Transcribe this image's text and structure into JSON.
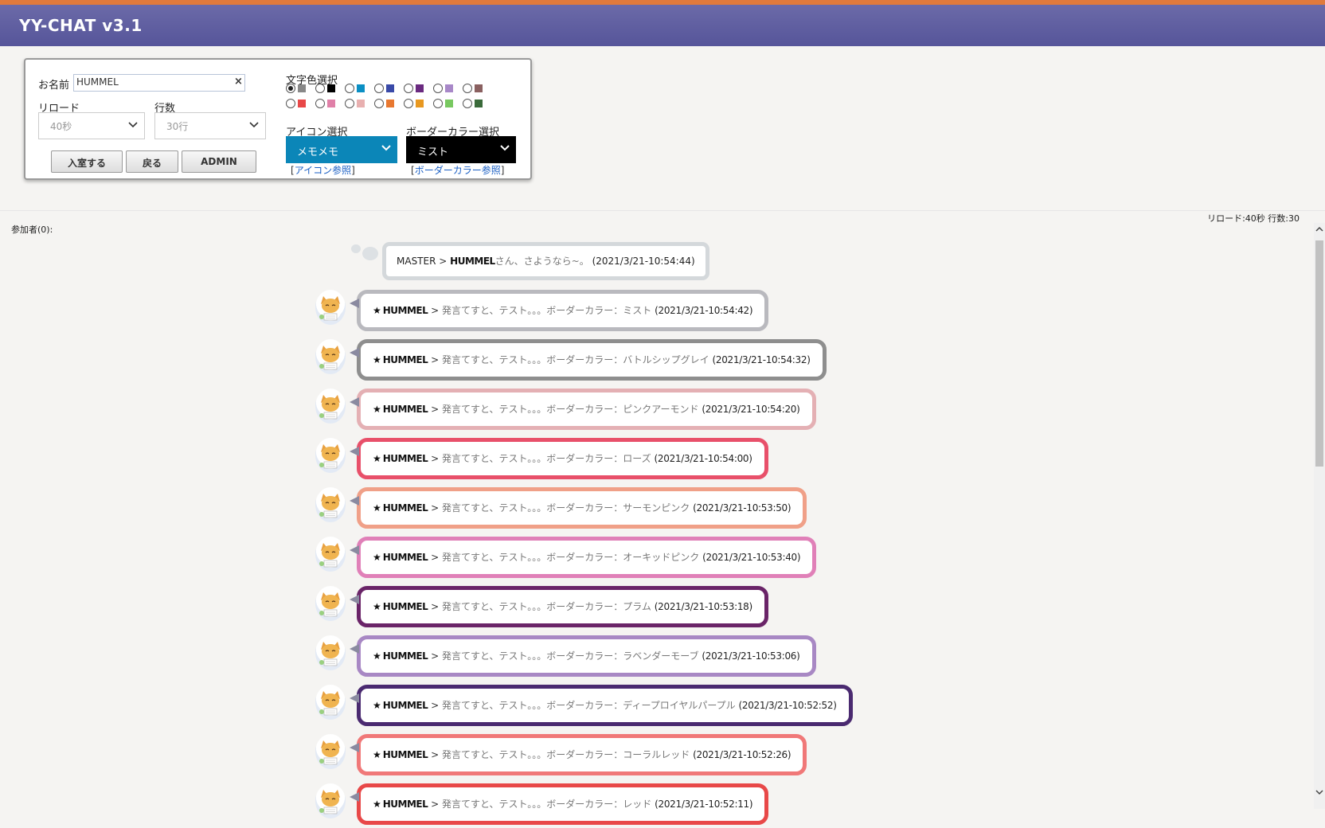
{
  "app": {
    "title": "YY-CHAT v3.1"
  },
  "form": {
    "name_label": "お名前",
    "name_value": "HUMMEL",
    "clear_label": "×",
    "reload_label": "リロード",
    "reload_value": "40秒",
    "lines_label": "行数",
    "lines_value": "30行",
    "enter_button": "入室する",
    "back_button": "戻る",
    "admin_button": "ADMIN",
    "text_color_label": "文字色選択",
    "text_colors": [
      "#888888",
      "#000000",
      "#0b8fc4",
      "#3a4aa8",
      "#6a2a80",
      "#a888c8",
      "#8a6060",
      "#e84848",
      "#e080a8",
      "#e8b0b0",
      "#e87830",
      "#e89820",
      "#78c860",
      "#3a6a3a"
    ],
    "icon_label": "アイコン選択",
    "icon_value": "メモメモ",
    "icon_link": "アイコン参照",
    "border_label": "ボーダーカラー選択",
    "border_value": "ミスト",
    "border_link": "ボーダーカラー参照",
    "bracket_open": "[",
    "bracket_close": "]"
  },
  "status": {
    "participants": "参加者(0):",
    "reload_info": "リロード:40秒 行数:30"
  },
  "master_message": {
    "name": "MASTER",
    "sep": ">",
    "body_name": "HUMMEL",
    "body": "さん、さようなら~。",
    "time": "(2021/3/21-10:54:44)"
  },
  "messages": [
    {
      "name": "HUMMEL",
      "sep": ">",
      "body": "発言てすと、テスト。。。ボーダーカラー：ミスト",
      "time": "(2021/3/21-10:54:42)",
      "border": "#b9b9be"
    },
    {
      "name": "HUMMEL",
      "sep": ">",
      "body": "発言てすと、テスト。。。ボーダーカラー：バトルシップグレイ",
      "time": "(2021/3/21-10:54:32)",
      "border": "#8e8e8e"
    },
    {
      "name": "HUMMEL",
      "sep": ">",
      "body": "発言てすと、テスト。。。ボーダーカラー：ピンクアーモンド",
      "time": "(2021/3/21-10:54:20)",
      "border": "#e4b0b4"
    },
    {
      "name": "HUMMEL",
      "sep": ">",
      "body": "発言てすと、テスト。。。ボーダーカラー：ローズ",
      "time": "(2021/3/21-10:54:00)",
      "border": "#e8506a"
    },
    {
      "name": "HUMMEL",
      "sep": ">",
      "body": "発言てすと、テスト。。。ボーダーカラー：サーモンピンク",
      "time": "(2021/3/21-10:53:50)",
      "border": "#f0a088"
    },
    {
      "name": "HUMMEL",
      "sep": ">",
      "body": "発言てすと、テスト。。。ボーダーカラー：オーキッドピンク",
      "time": "(2021/3/21-10:53:40)",
      "border": "#e080b8"
    },
    {
      "name": "HUMMEL",
      "sep": ">",
      "body": "発言てすと、テスト。。。ボーダーカラー：プラム",
      "time": "(2021/3/21-10:53:18)",
      "border": "#6a2468"
    },
    {
      "name": "HUMMEL",
      "sep": ">",
      "body": "発言てすと、テスト。。。ボーダーカラー：ラベンダーモーブ",
      "time": "(2021/3/21-10:53:06)",
      "border": "#a888c4"
    },
    {
      "name": "HUMMEL",
      "sep": ">",
      "body": "発言てすと、テスト。。。ボーダーカラー：ディープロイヤルパープル",
      "time": "(2021/3/21-10:52:52)",
      "border": "#4a2a70"
    },
    {
      "name": "HUMMEL",
      "sep": ">",
      "body": "発言てすと、テスト。。。ボーダーカラー：コーラルレッド",
      "time": "(2021/3/21-10:52:26)",
      "border": "#f07878"
    },
    {
      "name": "HUMMEL",
      "sep": ">",
      "body": "発言てすと、テスト。。。ボーダーカラー：レッド",
      "time": "(2021/3/21-10:52:11)",
      "border": "#e84848"
    }
  ]
}
